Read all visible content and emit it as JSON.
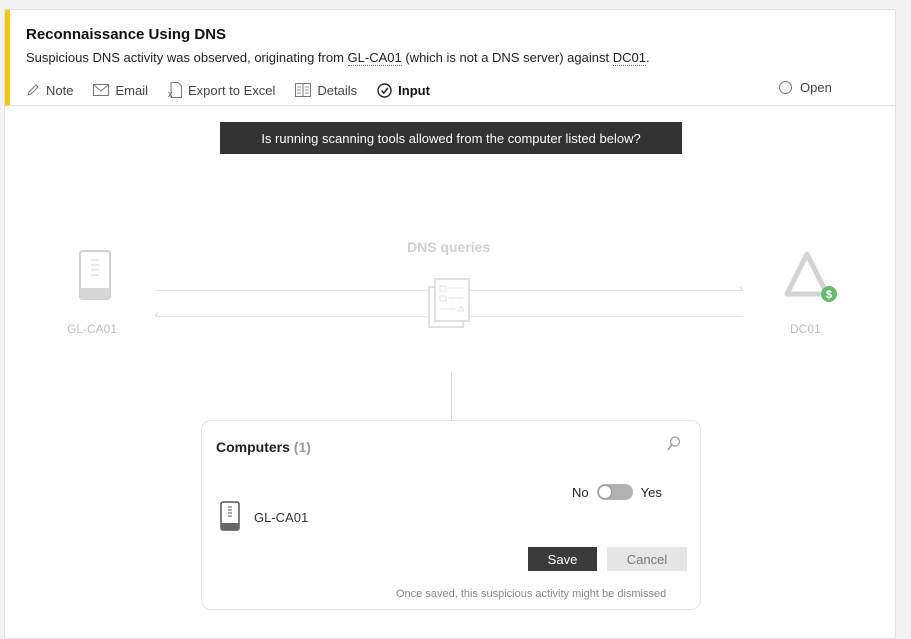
{
  "alert": {
    "title": "Reconnaissance Using DNS",
    "desc_pre": "Suspicious DNS activity was observed, originating from ",
    "source": "GL-CA01",
    "desc_mid": " (which is not a DNS server) against ",
    "target": "DC01",
    "desc_post": "."
  },
  "actions": [
    {
      "label": "Note",
      "icon": "pencil-icon"
    },
    {
      "label": "Email",
      "icon": "envelope-icon"
    },
    {
      "label": "Export to Excel",
      "icon": "excel-icon"
    },
    {
      "label": "Details",
      "icon": "details-icon"
    },
    {
      "label": "Input",
      "icon": "check-circle-icon"
    }
  ],
  "status": {
    "label": "Open"
  },
  "question": "Is running scanning tools allowed from the computer listed below?",
  "diagram": {
    "source_label": "GL-CA01",
    "target_label": "DC01",
    "edge_label": "DNS queries"
  },
  "panel": {
    "title": "Computers",
    "count": "(1)",
    "toggle_no": "No",
    "toggle_yes": "Yes",
    "computer": "GL-CA01",
    "save": "Save",
    "cancel": "Cancel",
    "footnote": "Once saved, this suspicious activity might be dismissed"
  },
  "colors": {
    "accent": "#f2c811",
    "banner": "#333333",
    "save": "#3a3a3a",
    "dc_badge": "#4caf50"
  }
}
